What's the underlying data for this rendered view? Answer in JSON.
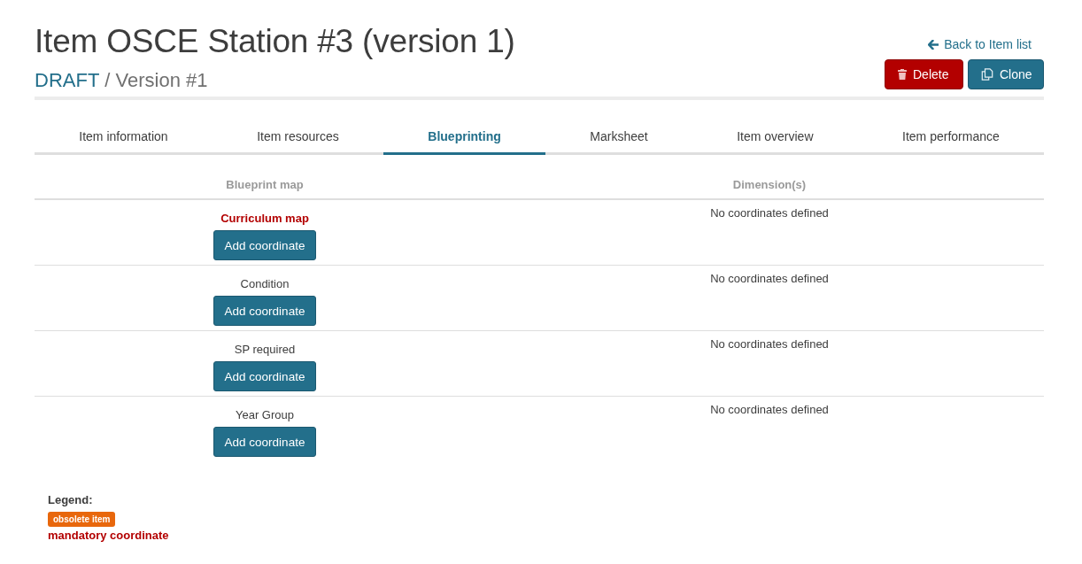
{
  "header": {
    "title": "Item OSCE Station #3 (version 1)",
    "status": "DRAFT",
    "version": "/ Version #1"
  },
  "actions": {
    "back_link": "Back to Item list",
    "buttons": [
      {
        "kind": "delete",
        "label": "Delete"
      },
      {
        "kind": "clone",
        "label": "Clone"
      }
    ]
  },
  "tabs": [
    {
      "label": "Item information",
      "selected": false
    },
    {
      "label": "Item resources",
      "selected": false
    },
    {
      "label": "Blueprinting",
      "selected": true
    },
    {
      "label": "Marksheet",
      "selected": false
    },
    {
      "label": "Item overview",
      "selected": false
    },
    {
      "label": "Item performance",
      "selected": false
    }
  ],
  "table": {
    "columns": [
      "Blueprint map",
      "Dimension(s)"
    ],
    "rows": [
      {
        "map": "Curriculum map",
        "mandatory": true,
        "action": "Add coordinate",
        "dimensions": "No coordinates defined"
      },
      {
        "map": "Condition",
        "mandatory": false,
        "action": "Add coordinate",
        "dimensions": "No coordinates defined"
      },
      {
        "map": "SP required",
        "mandatory": false,
        "action": "Add coordinate",
        "dimensions": "No coordinates defined"
      },
      {
        "map": "Year Group",
        "mandatory": false,
        "action": "Add coordinate",
        "dimensions": "No coordinates defined"
      }
    ]
  },
  "legend": {
    "title": "Legend:",
    "items": [
      {
        "kind": "badge",
        "label": "obsolete item"
      },
      {
        "kind": "mandatory",
        "label": "mandatory coordinate"
      }
    ]
  }
}
